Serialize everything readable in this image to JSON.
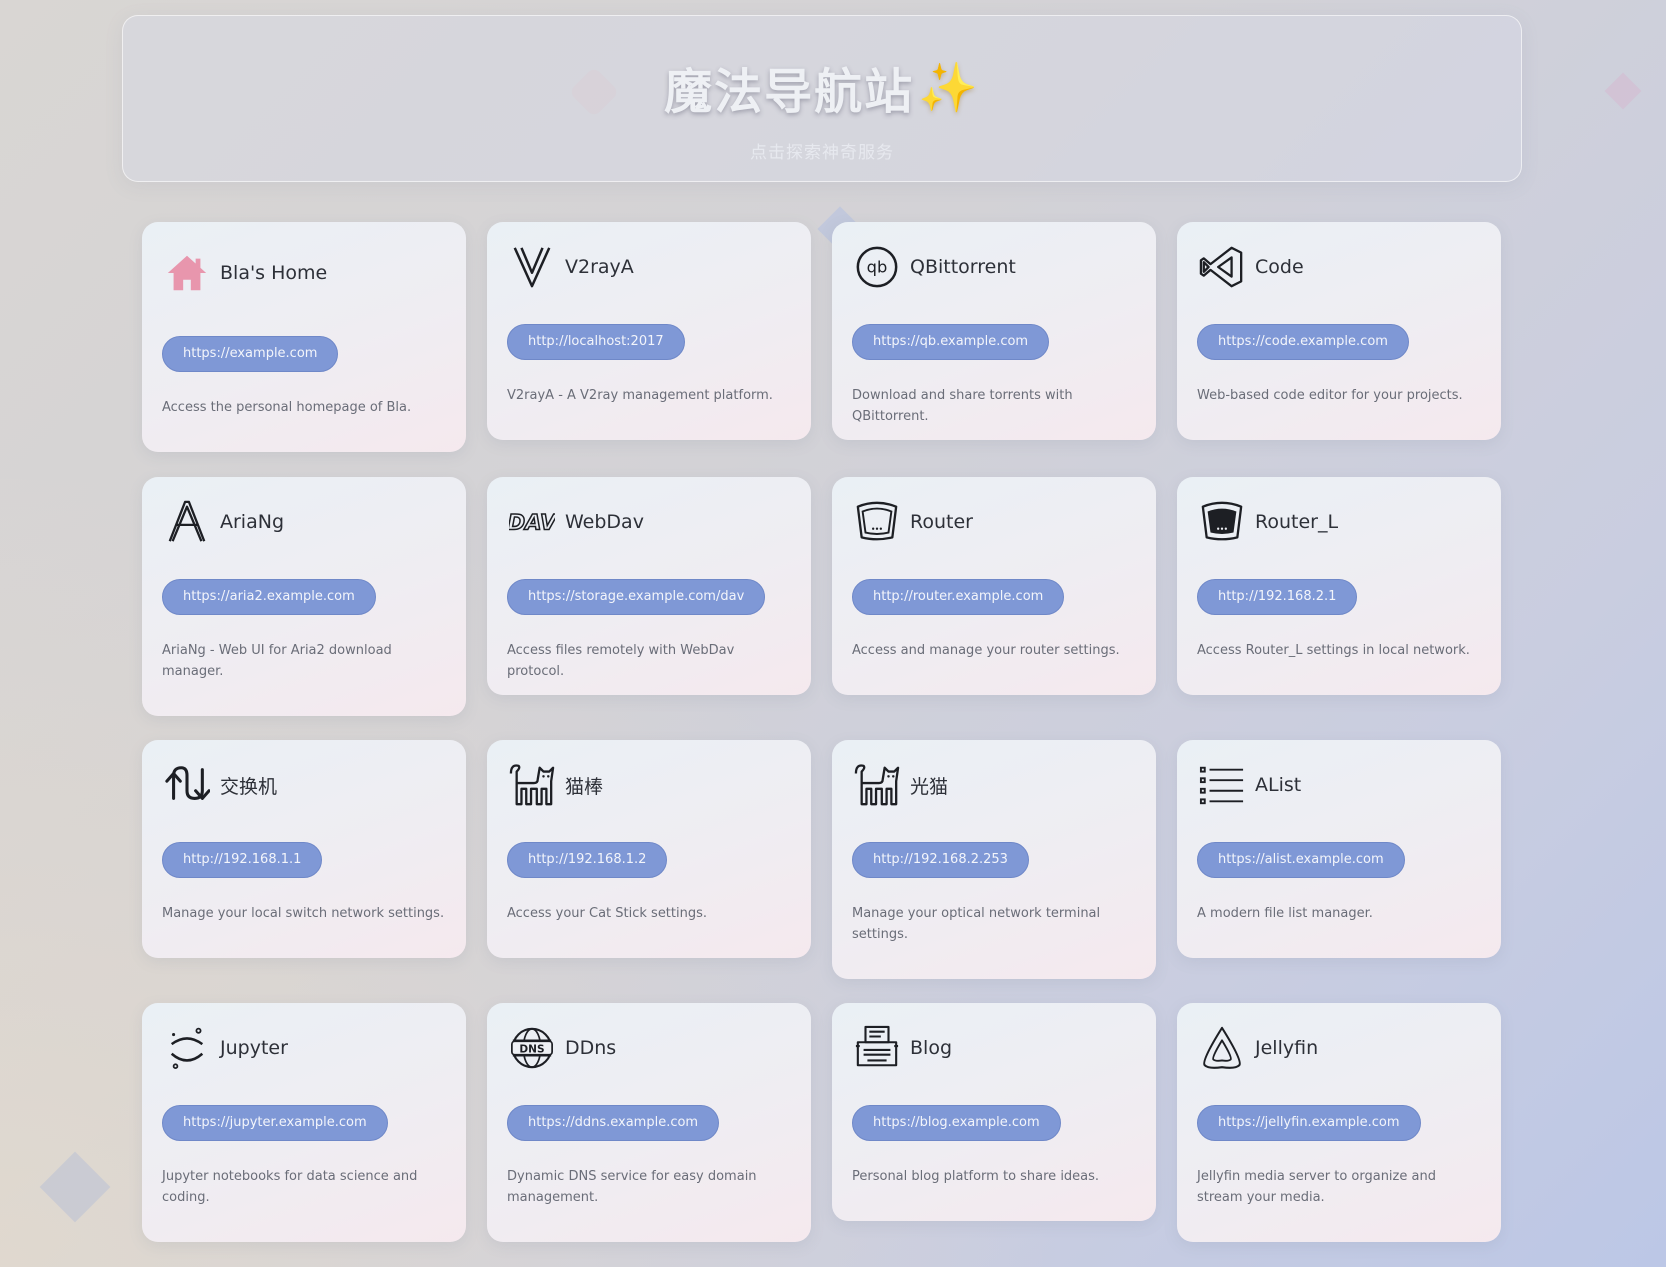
{
  "header": {
    "title": "魔法导航站",
    "title_emoji": "✨",
    "subtitle": "点击探索神奇服务"
  },
  "accent_color": "#7f98d6",
  "cards": [
    {
      "name": "Bla's Home",
      "icon": "house-icon",
      "url": "https://example.com",
      "description": "Access the personal homepage of Bla."
    },
    {
      "name": "V2rayA",
      "icon": "v-letter-icon",
      "url": "http://localhost:2017",
      "description": "V2rayA - A V2ray management platform."
    },
    {
      "name": "QBittorrent",
      "icon": "qbittorrent-icon",
      "url": "https://qb.example.com",
      "description": "Download and share torrents with QBittorrent."
    },
    {
      "name": "Code",
      "icon": "vscode-icon",
      "url": "https://code.example.com",
      "description": "Web-based code editor for your projects."
    },
    {
      "name": "AriaNg",
      "icon": "a-letter-icon",
      "url": "https://aria2.example.com",
      "description": "AriaNg - Web UI for Aria2 download manager."
    },
    {
      "name": "WebDav",
      "icon": "dav-icon",
      "url": "https://storage.example.com/dav",
      "description": "Access files remotely with WebDav protocol."
    },
    {
      "name": "Router",
      "icon": "router-outline-icon",
      "url": "http://router.example.com",
      "description": "Access and manage your router settings."
    },
    {
      "name": "Router_L",
      "icon": "router-filled-icon",
      "url": "http://192.168.2.1",
      "description": "Access Router_L settings in local network."
    },
    {
      "name": "交换机",
      "icon": "switch-arrows-icon",
      "url": "http://192.168.1.1",
      "description": "Manage your local switch network settings."
    },
    {
      "name": "猫棒",
      "icon": "cat-icon",
      "url": "http://192.168.1.2",
      "description": "Access your Cat Stick settings."
    },
    {
      "name": "光猫",
      "icon": "cat-icon",
      "url": "http://192.168.2.253",
      "description": "Manage your optical network terminal settings."
    },
    {
      "name": "AList",
      "icon": "list-icon",
      "url": "https://alist.example.com",
      "description": "A modern file list manager."
    },
    {
      "name": "Jupyter",
      "icon": "jupyter-icon",
      "url": "https://jupyter.example.com",
      "description": "Jupyter notebooks for data science and coding."
    },
    {
      "name": "DDns",
      "icon": "dns-globe-icon",
      "url": "https://ddns.example.com",
      "description": "Dynamic DNS service for easy domain management."
    },
    {
      "name": "Blog",
      "icon": "typewriter-icon",
      "url": "https://blog.example.com",
      "description": "Personal blog platform to share ideas."
    },
    {
      "name": "Jellyfin",
      "icon": "jellyfin-icon",
      "url": "https://jellyfin.example.com",
      "description": "Jellyfin media server to organize and stream your media."
    }
  ]
}
